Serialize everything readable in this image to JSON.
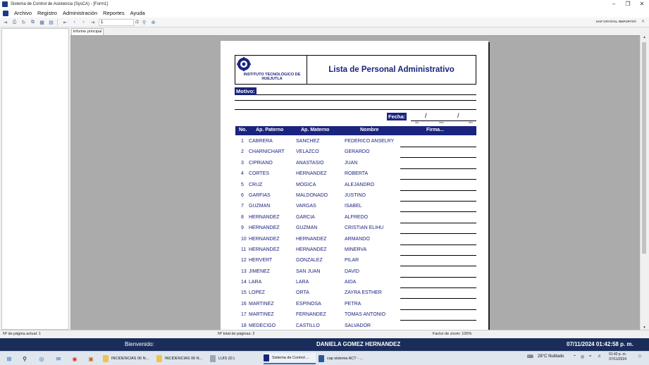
{
  "window": {
    "title": "Sistema de Control de Asistencia (SysCA) - [Form1]"
  },
  "menu": [
    "Archivo",
    "Registro",
    "Administración",
    "Reportes",
    "Ayuda"
  ],
  "toolbar": {
    "page_value": "1",
    "page_total": "/2",
    "brand": "SAP CRYSTAL REPORTS®"
  },
  "tab": {
    "label": "Informe principal"
  },
  "report": {
    "institute": "INSTITUTO TECNOLÓGICO DE HUEJUTLA",
    "title": "Lista de Personal Administrativo",
    "motivo_label": "Motivo:",
    "fecha_label": "Fecha:",
    "date_parts": [
      "día",
      "mes",
      "año"
    ],
    "columns": [
      "No.",
      "Ap. Paterno",
      "Ap. Materno",
      "Nombre",
      "Firma..."
    ],
    "rows": [
      {
        "no": "1",
        "pat": "CABRERA",
        "mat": "SANCHEZ",
        "nom": "FEDERICO ANSELRY"
      },
      {
        "no": "2",
        "pat": "CHARNICHART",
        "mat": "VELAZCO",
        "nom": "GERARDO"
      },
      {
        "no": "3",
        "pat": "CIPRIANO",
        "mat": "ANASTASIO",
        "nom": "JUAN"
      },
      {
        "no": "4",
        "pat": "CORTES",
        "mat": "HERNANDEZ",
        "nom": "ROBERTA"
      },
      {
        "no": "5",
        "pat": "CRUZ",
        "mat": "MOGICA",
        "nom": "ALEJANDRO"
      },
      {
        "no": "6",
        "pat": "GARFIAS",
        "mat": "MALDONADO",
        "nom": "JUSTINO"
      },
      {
        "no": "7",
        "pat": "GUZMAN",
        "mat": "VARGAS",
        "nom": "ISABEL"
      },
      {
        "no": "8",
        "pat": "HERNANDEZ",
        "mat": "GARCIA",
        "nom": "ALFREDO"
      },
      {
        "no": "9",
        "pat": "HERNANDEZ",
        "mat": "GUZMAN",
        "nom": "CRISTIAN ELIHU"
      },
      {
        "no": "10",
        "pat": "HERNANDEZ",
        "mat": "HERNANDEZ",
        "nom": "ARMANDO"
      },
      {
        "no": "11",
        "pat": "HERNANDEZ",
        "mat": "HERNANDEZ",
        "nom": "MINERVA"
      },
      {
        "no": "12",
        "pat": "HERVERT",
        "mat": "GONZALEZ",
        "nom": "PILAR"
      },
      {
        "no": "13",
        "pat": "JIMENEZ",
        "mat": "SAN  JUAN",
        "nom": "DAVID"
      },
      {
        "no": "14",
        "pat": "LARA",
        "mat": "LARA",
        "nom": "AIDA"
      },
      {
        "no": "15",
        "pat": "LOPEZ",
        "mat": "ORTA",
        "nom": "ZAYRA  ESTHER"
      },
      {
        "no": "16",
        "pat": "MARTINEZ",
        "mat": "ESPINOSA",
        "nom": "PETRA"
      },
      {
        "no": "17",
        "pat": "MARTINEZ",
        "mat": "FERNANDEZ",
        "nom": "TOMAS ANTONIO"
      },
      {
        "no": "18",
        "pat": "MEDECIGO",
        "mat": "CASTILLO",
        "nom": "SALVADOR"
      }
    ]
  },
  "status": {
    "current_page": "Nº de página actual: 1",
    "total_pages": "Nº total de páginas: 2",
    "zoom": "Factor de zoom: 100%"
  },
  "footer": {
    "welcome": "Bienvenido:",
    "user": "DANIELA GOMEZ HERNANDEZ",
    "datetime": "07/11/2024 01:42:58 p. m."
  },
  "taskbar": {
    "apps": [
      {
        "label": "INCIDENCIAS 06 N...",
        "color": "#f2c14e"
      },
      {
        "label": "INCIDENCIAS 06 N...",
        "color": "#f2c14e"
      },
      {
        "label": "LUIS (D:)",
        "color": "#9aa7b5"
      },
      {
        "label": "Sistema de Control ...",
        "color": "#1a237e"
      },
      {
        "label": "cap sistema ACT - ...",
        "color": "#2b5797"
      }
    ],
    "weather": "28°C  Nublado",
    "time": "01:42 p. m.",
    "date": "07/11/2024"
  }
}
